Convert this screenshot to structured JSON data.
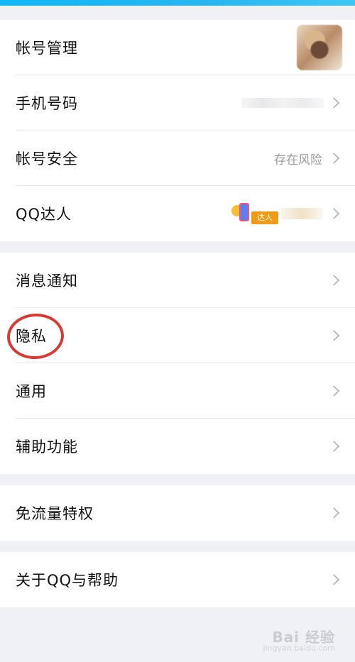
{
  "groups": {
    "account": {
      "rows": [
        {
          "label": "帐号管理"
        },
        {
          "label": "手机号码"
        },
        {
          "label": "帐号安全",
          "value": "存在风险"
        },
        {
          "label": "QQ达人",
          "badge_text": "达人"
        }
      ]
    },
    "settings": {
      "rows": [
        {
          "label": "消息通知"
        },
        {
          "label": "隐私"
        },
        {
          "label": "通用"
        },
        {
          "label": "辅助功能"
        }
      ]
    },
    "traffic": {
      "rows": [
        {
          "label": "免流量特权"
        }
      ]
    },
    "about": {
      "rows": [
        {
          "label": "关于QQ与帮助"
        }
      ]
    }
  },
  "watermark": {
    "brand": "Bai 经验",
    "url": "jingyan.baidu.com"
  },
  "colors": {
    "accent": "#12b7f5",
    "highlight_circle": "#d83a33",
    "badge": "#f19a16",
    "secondary_text": "#9a9ca3"
  }
}
